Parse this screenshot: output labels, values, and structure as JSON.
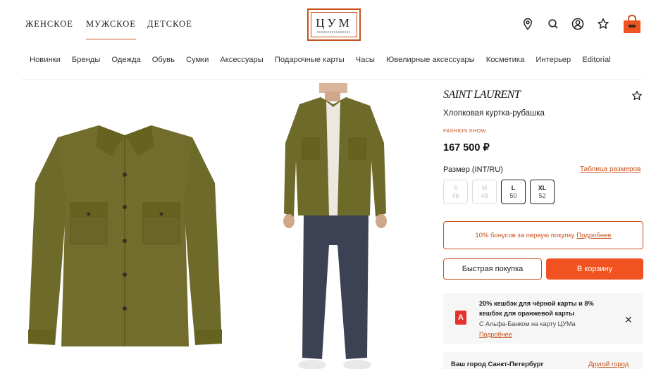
{
  "header": {
    "genders": [
      "ЖЕНСКОЕ",
      "МУЖСКОЕ",
      "ДЕТСКОЕ"
    ],
    "active_gender": "МУЖСКОЕ",
    "logo": "ЦУМ",
    "icons": [
      "location-icon",
      "search-icon",
      "user-icon",
      "star-icon",
      "bag-icon"
    ],
    "accent_color": "#c8511b"
  },
  "nav": {
    "items": [
      "Новинки",
      "Бренды",
      "Одежда",
      "Обувь",
      "Сумки",
      "Аксессуары",
      "Подарочные карты",
      "Часы",
      "Ювелирные аксессуары",
      "Косметика",
      "Интерьер",
      "Editorial"
    ]
  },
  "product": {
    "brand": "SAINT LAURENT",
    "name": "Хлопковая куртка-рубашка",
    "badge": "FASHION SHOW",
    "price": "167 500 ₽",
    "size_label": "Размер (INT/RU)",
    "size_table_link": "Таблица размеров",
    "sizes": [
      {
        "int": "S",
        "ru": "46",
        "available": false
      },
      {
        "int": "M",
        "ru": "48",
        "available": false
      },
      {
        "int": "L",
        "ru": "50",
        "available": true
      },
      {
        "int": "XL",
        "ru": "52",
        "available": true
      }
    ],
    "bonus_text": "10% бонусов за первую покупку",
    "bonus_link": "Подробнее",
    "quick_buy": "Быстрая покупка",
    "add_to_cart": "В корзину",
    "cart_color": "#f0531f"
  },
  "promo": {
    "title": "20% кешбэк для чёрной карты и 8% кешбэк для оранжевой карты",
    "subtitle": "С Альфа-Банком на карту ЦУМа",
    "link": "Подробнее",
    "bank_letter": "А"
  },
  "city": {
    "text": "Ваш город Санкт-Петербург",
    "link": "Другой город"
  }
}
